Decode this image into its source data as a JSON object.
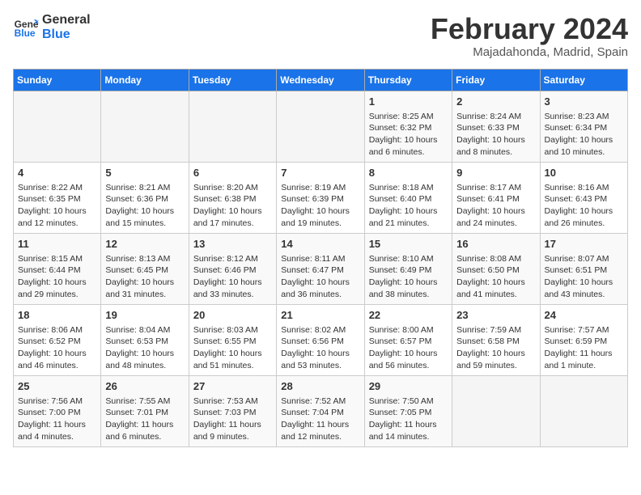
{
  "logo": {
    "line1": "General",
    "line2": "Blue"
  },
  "title": "February 2024",
  "subtitle": "Majadahonda, Madrid, Spain",
  "weekdays": [
    "Sunday",
    "Monday",
    "Tuesday",
    "Wednesday",
    "Thursday",
    "Friday",
    "Saturday"
  ],
  "weeks": [
    [
      {
        "day": "",
        "info": ""
      },
      {
        "day": "",
        "info": ""
      },
      {
        "day": "",
        "info": ""
      },
      {
        "day": "",
        "info": ""
      },
      {
        "day": "1",
        "info": "Sunrise: 8:25 AM\nSunset: 6:32 PM\nDaylight: 10 hours\nand 6 minutes."
      },
      {
        "day": "2",
        "info": "Sunrise: 8:24 AM\nSunset: 6:33 PM\nDaylight: 10 hours\nand 8 minutes."
      },
      {
        "day": "3",
        "info": "Sunrise: 8:23 AM\nSunset: 6:34 PM\nDaylight: 10 hours\nand 10 minutes."
      }
    ],
    [
      {
        "day": "4",
        "info": "Sunrise: 8:22 AM\nSunset: 6:35 PM\nDaylight: 10 hours\nand 12 minutes."
      },
      {
        "day": "5",
        "info": "Sunrise: 8:21 AM\nSunset: 6:36 PM\nDaylight: 10 hours\nand 15 minutes."
      },
      {
        "day": "6",
        "info": "Sunrise: 8:20 AM\nSunset: 6:38 PM\nDaylight: 10 hours\nand 17 minutes."
      },
      {
        "day": "7",
        "info": "Sunrise: 8:19 AM\nSunset: 6:39 PM\nDaylight: 10 hours\nand 19 minutes."
      },
      {
        "day": "8",
        "info": "Sunrise: 8:18 AM\nSunset: 6:40 PM\nDaylight: 10 hours\nand 21 minutes."
      },
      {
        "day": "9",
        "info": "Sunrise: 8:17 AM\nSunset: 6:41 PM\nDaylight: 10 hours\nand 24 minutes."
      },
      {
        "day": "10",
        "info": "Sunrise: 8:16 AM\nSunset: 6:43 PM\nDaylight: 10 hours\nand 26 minutes."
      }
    ],
    [
      {
        "day": "11",
        "info": "Sunrise: 8:15 AM\nSunset: 6:44 PM\nDaylight: 10 hours\nand 29 minutes."
      },
      {
        "day": "12",
        "info": "Sunrise: 8:13 AM\nSunset: 6:45 PM\nDaylight: 10 hours\nand 31 minutes."
      },
      {
        "day": "13",
        "info": "Sunrise: 8:12 AM\nSunset: 6:46 PM\nDaylight: 10 hours\nand 33 minutes."
      },
      {
        "day": "14",
        "info": "Sunrise: 8:11 AM\nSunset: 6:47 PM\nDaylight: 10 hours\nand 36 minutes."
      },
      {
        "day": "15",
        "info": "Sunrise: 8:10 AM\nSunset: 6:49 PM\nDaylight: 10 hours\nand 38 minutes."
      },
      {
        "day": "16",
        "info": "Sunrise: 8:08 AM\nSunset: 6:50 PM\nDaylight: 10 hours\nand 41 minutes."
      },
      {
        "day": "17",
        "info": "Sunrise: 8:07 AM\nSunset: 6:51 PM\nDaylight: 10 hours\nand 43 minutes."
      }
    ],
    [
      {
        "day": "18",
        "info": "Sunrise: 8:06 AM\nSunset: 6:52 PM\nDaylight: 10 hours\nand 46 minutes."
      },
      {
        "day": "19",
        "info": "Sunrise: 8:04 AM\nSunset: 6:53 PM\nDaylight: 10 hours\nand 48 minutes."
      },
      {
        "day": "20",
        "info": "Sunrise: 8:03 AM\nSunset: 6:55 PM\nDaylight: 10 hours\nand 51 minutes."
      },
      {
        "day": "21",
        "info": "Sunrise: 8:02 AM\nSunset: 6:56 PM\nDaylight: 10 hours\nand 53 minutes."
      },
      {
        "day": "22",
        "info": "Sunrise: 8:00 AM\nSunset: 6:57 PM\nDaylight: 10 hours\nand 56 minutes."
      },
      {
        "day": "23",
        "info": "Sunrise: 7:59 AM\nSunset: 6:58 PM\nDaylight: 10 hours\nand 59 minutes."
      },
      {
        "day": "24",
        "info": "Sunrise: 7:57 AM\nSunset: 6:59 PM\nDaylight: 11 hours\nand 1 minute."
      }
    ],
    [
      {
        "day": "25",
        "info": "Sunrise: 7:56 AM\nSunset: 7:00 PM\nDaylight: 11 hours\nand 4 minutes."
      },
      {
        "day": "26",
        "info": "Sunrise: 7:55 AM\nSunset: 7:01 PM\nDaylight: 11 hours\nand 6 minutes."
      },
      {
        "day": "27",
        "info": "Sunrise: 7:53 AM\nSunset: 7:03 PM\nDaylight: 11 hours\nand 9 minutes."
      },
      {
        "day": "28",
        "info": "Sunrise: 7:52 AM\nSunset: 7:04 PM\nDaylight: 11 hours\nand 12 minutes."
      },
      {
        "day": "29",
        "info": "Sunrise: 7:50 AM\nSunset: 7:05 PM\nDaylight: 11 hours\nand 14 minutes."
      },
      {
        "day": "",
        "info": ""
      },
      {
        "day": "",
        "info": ""
      }
    ]
  ]
}
